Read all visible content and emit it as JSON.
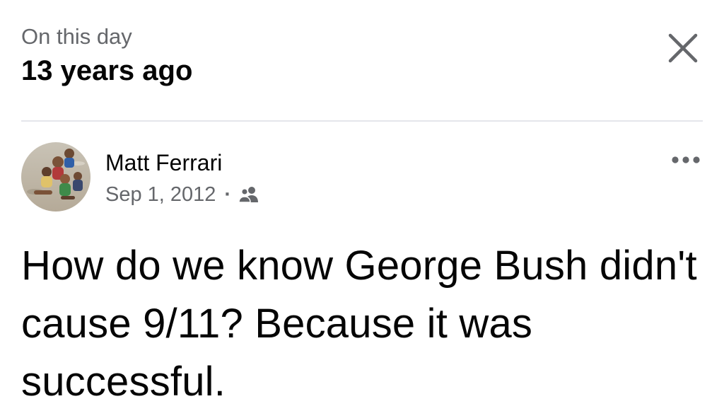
{
  "header": {
    "eyebrow": "On this day",
    "title": "13 years ago",
    "close_icon": "close-icon"
  },
  "post": {
    "author": {
      "name": "Matt Ferrari",
      "avatar": "avatar-photo"
    },
    "date": "Sep 1, 2012",
    "separator": "·",
    "audience_icon": "friends-icon",
    "more_icon": "more-options-icon",
    "text": "How do we know George Bush didn't cause 9/11? Because it was successful."
  },
  "colors": {
    "text_primary": "#050505",
    "text_secondary": "#65676b",
    "divider": "#e4e6eb",
    "background": "#ffffff"
  }
}
